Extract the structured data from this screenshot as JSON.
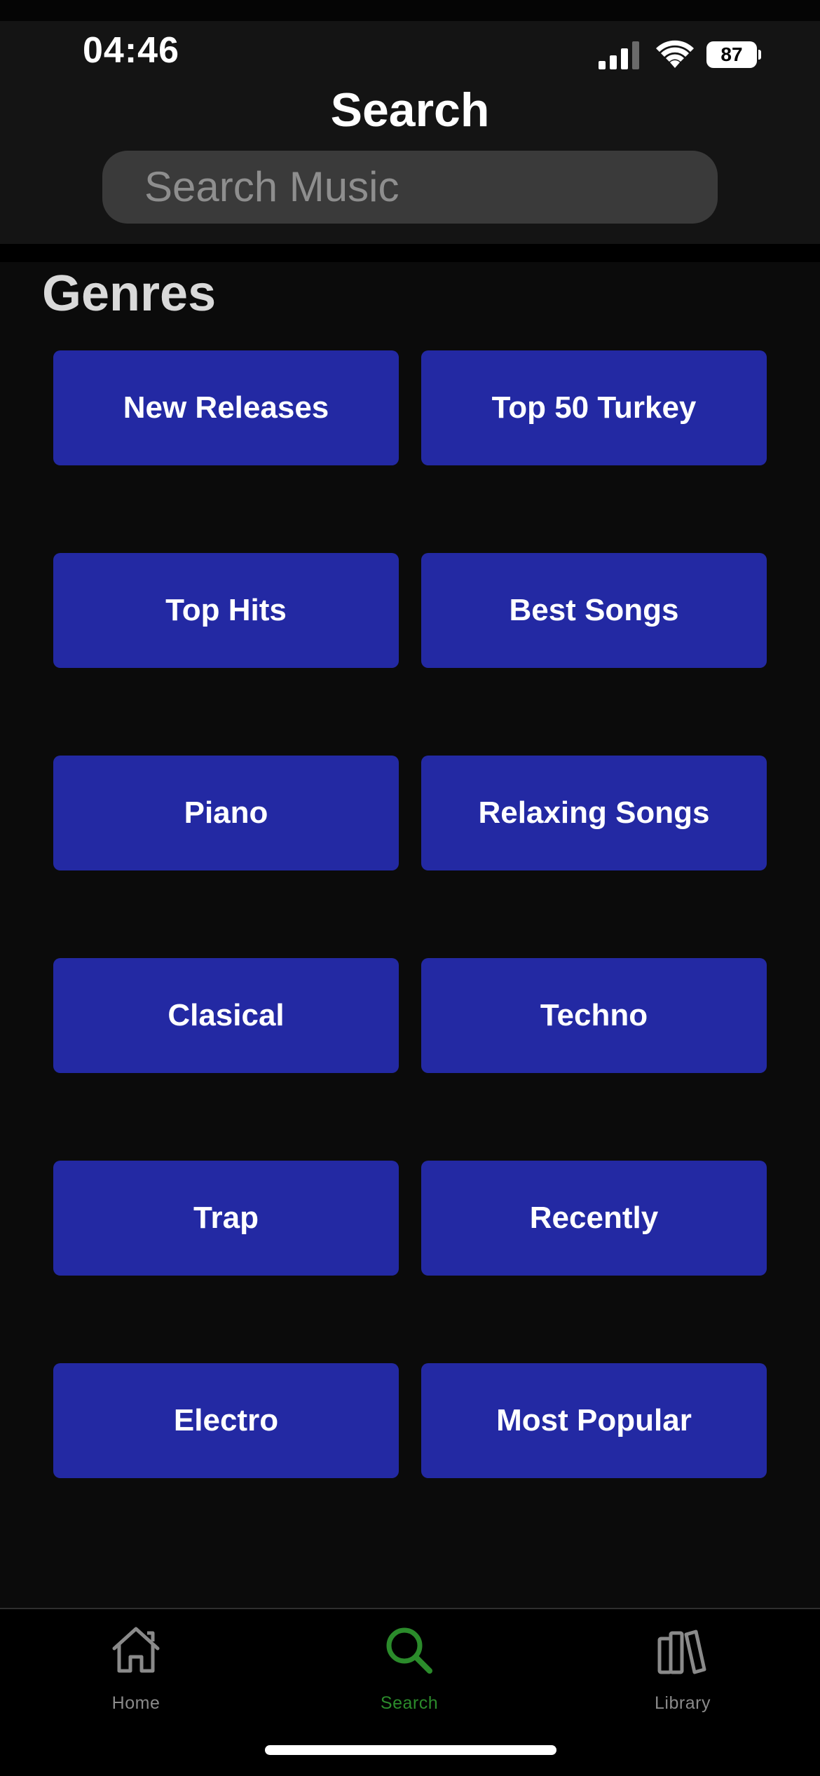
{
  "status_bar": {
    "time": "04:46",
    "battery": "87",
    "icons": [
      "signal-icon",
      "wifi-icon",
      "battery-icon"
    ]
  },
  "header": {
    "title": "Search",
    "search_placeholder": "Search Music"
  },
  "section": {
    "title": "Genres"
  },
  "genres": [
    "New Releases",
    "Top 50 Turkey",
    "Top Hits",
    "Best Songs",
    "Piano",
    "Relaxing Songs",
    "Clasical",
    "Techno",
    "Trap",
    "Recently",
    "Electro",
    "Most Popular"
  ],
  "tab_bar": {
    "items": [
      {
        "label": "Home",
        "icon": "home-icon"
      },
      {
        "label": "Search",
        "icon": "search-icon",
        "selected": true
      },
      {
        "label": "Library",
        "icon": "library-icon"
      }
    ]
  },
  "colors": {
    "background": "#0b0b0b",
    "header": "#141414",
    "genre_button": "#2329a3",
    "tab_active": "#2b8b2b",
    "tab_inactive": "#8a8a8a"
  }
}
